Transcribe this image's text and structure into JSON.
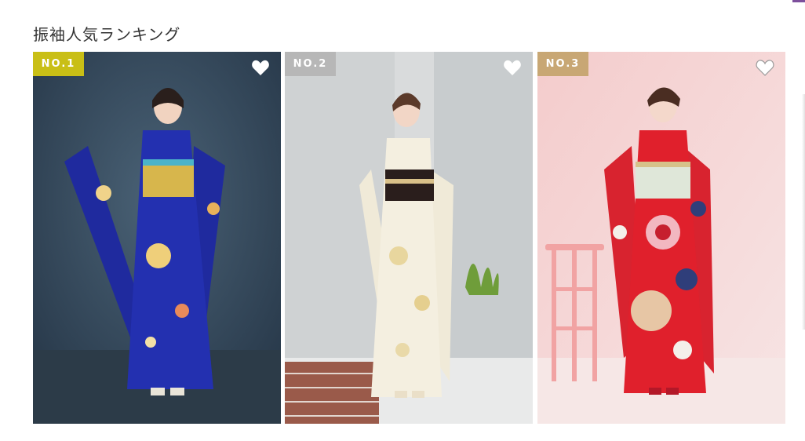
{
  "section": {
    "title": "振袖人気ランキング"
  },
  "cards": [
    {
      "rank": "NO.1",
      "badge_color": "#c9bf16",
      "heart_icon": "heart-icon",
      "photo": "model in royal blue furisode with floral print and gold obi"
    },
    {
      "rank": "NO.2",
      "badge_color": "#b7b7b7",
      "heart_icon": "heart-icon",
      "photo": "model in ivory furisode with gold floral pattern and black obi"
    },
    {
      "rank": "NO.3",
      "badge_color": "#c8a774",
      "heart_icon": "heart-icon",
      "photo": "model in red furisode with large flower circles beside pink stool"
    }
  ],
  "colors": {
    "accent": "#7d4f9c",
    "title_text": "#333333"
  }
}
